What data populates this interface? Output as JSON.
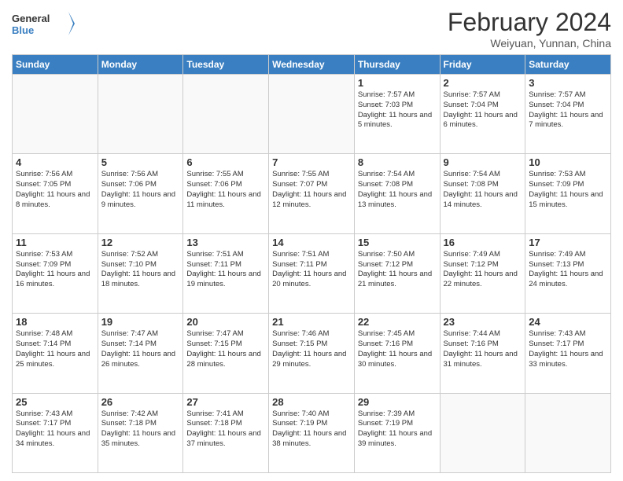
{
  "logo": {
    "text_general": "General",
    "text_blue": "Blue"
  },
  "header": {
    "month_year": "February 2024",
    "location": "Weiyuan, Yunnan, China"
  },
  "weekdays": [
    "Sunday",
    "Monday",
    "Tuesday",
    "Wednesday",
    "Thursday",
    "Friday",
    "Saturday"
  ],
  "weeks": [
    [
      {
        "day": "",
        "info": ""
      },
      {
        "day": "",
        "info": ""
      },
      {
        "day": "",
        "info": ""
      },
      {
        "day": "",
        "info": ""
      },
      {
        "day": "1",
        "info": "Sunrise: 7:57 AM\nSunset: 7:03 PM\nDaylight: 11 hours and 5 minutes."
      },
      {
        "day": "2",
        "info": "Sunrise: 7:57 AM\nSunset: 7:04 PM\nDaylight: 11 hours and 6 minutes."
      },
      {
        "day": "3",
        "info": "Sunrise: 7:57 AM\nSunset: 7:04 PM\nDaylight: 11 hours and 7 minutes."
      }
    ],
    [
      {
        "day": "4",
        "info": "Sunrise: 7:56 AM\nSunset: 7:05 PM\nDaylight: 11 hours and 8 minutes."
      },
      {
        "day": "5",
        "info": "Sunrise: 7:56 AM\nSunset: 7:06 PM\nDaylight: 11 hours and 9 minutes."
      },
      {
        "day": "6",
        "info": "Sunrise: 7:55 AM\nSunset: 7:06 PM\nDaylight: 11 hours and 11 minutes."
      },
      {
        "day": "7",
        "info": "Sunrise: 7:55 AM\nSunset: 7:07 PM\nDaylight: 11 hours and 12 minutes."
      },
      {
        "day": "8",
        "info": "Sunrise: 7:54 AM\nSunset: 7:08 PM\nDaylight: 11 hours and 13 minutes."
      },
      {
        "day": "9",
        "info": "Sunrise: 7:54 AM\nSunset: 7:08 PM\nDaylight: 11 hours and 14 minutes."
      },
      {
        "day": "10",
        "info": "Sunrise: 7:53 AM\nSunset: 7:09 PM\nDaylight: 11 hours and 15 minutes."
      }
    ],
    [
      {
        "day": "11",
        "info": "Sunrise: 7:53 AM\nSunset: 7:09 PM\nDaylight: 11 hours and 16 minutes."
      },
      {
        "day": "12",
        "info": "Sunrise: 7:52 AM\nSunset: 7:10 PM\nDaylight: 11 hours and 18 minutes."
      },
      {
        "day": "13",
        "info": "Sunrise: 7:51 AM\nSunset: 7:11 PM\nDaylight: 11 hours and 19 minutes."
      },
      {
        "day": "14",
        "info": "Sunrise: 7:51 AM\nSunset: 7:11 PM\nDaylight: 11 hours and 20 minutes."
      },
      {
        "day": "15",
        "info": "Sunrise: 7:50 AM\nSunset: 7:12 PM\nDaylight: 11 hours and 21 minutes."
      },
      {
        "day": "16",
        "info": "Sunrise: 7:49 AM\nSunset: 7:12 PM\nDaylight: 11 hours and 22 minutes."
      },
      {
        "day": "17",
        "info": "Sunrise: 7:49 AM\nSunset: 7:13 PM\nDaylight: 11 hours and 24 minutes."
      }
    ],
    [
      {
        "day": "18",
        "info": "Sunrise: 7:48 AM\nSunset: 7:14 PM\nDaylight: 11 hours and 25 minutes."
      },
      {
        "day": "19",
        "info": "Sunrise: 7:47 AM\nSunset: 7:14 PM\nDaylight: 11 hours and 26 minutes."
      },
      {
        "day": "20",
        "info": "Sunrise: 7:47 AM\nSunset: 7:15 PM\nDaylight: 11 hours and 28 minutes."
      },
      {
        "day": "21",
        "info": "Sunrise: 7:46 AM\nSunset: 7:15 PM\nDaylight: 11 hours and 29 minutes."
      },
      {
        "day": "22",
        "info": "Sunrise: 7:45 AM\nSunset: 7:16 PM\nDaylight: 11 hours and 30 minutes."
      },
      {
        "day": "23",
        "info": "Sunrise: 7:44 AM\nSunset: 7:16 PM\nDaylight: 11 hours and 31 minutes."
      },
      {
        "day": "24",
        "info": "Sunrise: 7:43 AM\nSunset: 7:17 PM\nDaylight: 11 hours and 33 minutes."
      }
    ],
    [
      {
        "day": "25",
        "info": "Sunrise: 7:43 AM\nSunset: 7:17 PM\nDaylight: 11 hours and 34 minutes."
      },
      {
        "day": "26",
        "info": "Sunrise: 7:42 AM\nSunset: 7:18 PM\nDaylight: 11 hours and 35 minutes."
      },
      {
        "day": "27",
        "info": "Sunrise: 7:41 AM\nSunset: 7:18 PM\nDaylight: 11 hours and 37 minutes."
      },
      {
        "day": "28",
        "info": "Sunrise: 7:40 AM\nSunset: 7:19 PM\nDaylight: 11 hours and 38 minutes."
      },
      {
        "day": "29",
        "info": "Sunrise: 7:39 AM\nSunset: 7:19 PM\nDaylight: 11 hours and 39 minutes."
      },
      {
        "day": "",
        "info": ""
      },
      {
        "day": "",
        "info": ""
      }
    ]
  ]
}
